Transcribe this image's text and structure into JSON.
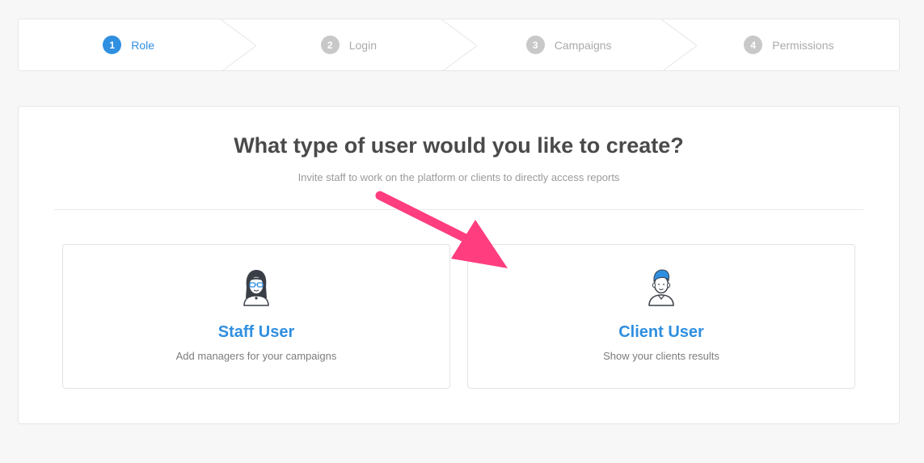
{
  "stepper": {
    "steps": [
      {
        "number": "1",
        "label": "Role",
        "active": true
      },
      {
        "number": "2",
        "label": "Login",
        "active": false
      },
      {
        "number": "3",
        "label": "Campaigns",
        "active": false
      },
      {
        "number": "4",
        "label": "Permissions",
        "active": false
      }
    ]
  },
  "main": {
    "title": "What type of user would you like to create?",
    "subtitle": "Invite staff to work on the platform or clients to directly access reports",
    "options": [
      {
        "title": "Staff User",
        "description": "Add managers for your campaigns",
        "icon": "staff-avatar-icon"
      },
      {
        "title": "Client User",
        "description": "Show your clients results",
        "icon": "client-avatar-icon"
      }
    ]
  },
  "colors": {
    "accent": "#2f8fe0",
    "annotation_arrow": "#ff3d7f",
    "inactive_step": "#c8c8c8"
  }
}
